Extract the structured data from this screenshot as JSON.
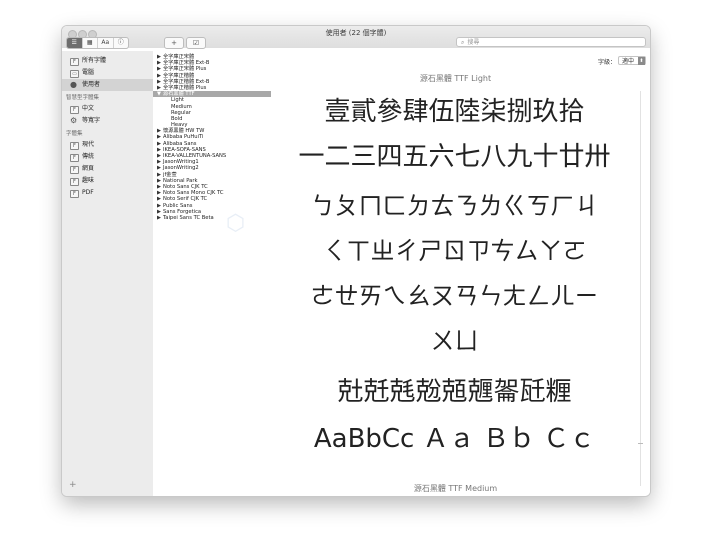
{
  "window": {
    "title": "使用者 (22 個字體)"
  },
  "toolbar": {
    "view_buttons": [
      "☰",
      "▦",
      "Aa",
      "ⓘ"
    ],
    "add_label": "+",
    "check_label": "☑",
    "search_placeholder": "搜尋"
  },
  "sidebar": {
    "collections": [
      {
        "label": "所有字體",
        "icon": "font-book-icon"
      },
      {
        "label": "電腦",
        "icon": "computer-icon"
      },
      {
        "label": "使用者",
        "icon": "user-icon",
        "selected": true
      }
    ],
    "smart_heading": "智慧型字體集",
    "smart_items": [
      {
        "label": "中文",
        "icon": "collection-icon"
      },
      {
        "label": "等寬字",
        "icon": "gear-icon"
      }
    ],
    "sets_heading": "字體集",
    "sets": [
      {
        "label": "現代",
        "icon": "collection-icon"
      },
      {
        "label": "傳統",
        "icon": "collection-icon"
      },
      {
        "label": "網頁",
        "icon": "collection-icon"
      },
      {
        "label": "趣味",
        "icon": "collection-icon"
      },
      {
        "label": "PDF",
        "icon": "collection-icon"
      }
    ],
    "add_label": "+"
  },
  "font_list": [
    {
      "label": "全字庫正宋體",
      "expanded": false
    },
    {
      "label": "全字庫正宋體 Ext-B",
      "expanded": false
    },
    {
      "label": "全字庫正宋體 Plus",
      "expanded": false
    },
    {
      "label": "全字庫正楷體",
      "expanded": false
    },
    {
      "label": "全字庫正楷體 Ext-B",
      "expanded": false
    },
    {
      "label": "全字庫正楷體 Plus",
      "expanded": false
    },
    {
      "label": "源石黑體 TTF",
      "expanded": true,
      "selected": true,
      "faces": [
        "Light",
        "Medium",
        "Regular",
        "Bold",
        "Heavy"
      ]
    },
    {
      "label": "懷源黑體 HW TW",
      "expanded": false
    },
    {
      "label": "Alibaba PuHuiTi",
      "expanded": false
    },
    {
      "label": "Alibaba Sans",
      "expanded": false
    },
    {
      "label": "IKEA-SOFA-SANS",
      "expanded": false
    },
    {
      "label": "IKEA-VALLENTUNA-SANS",
      "expanded": false
    },
    {
      "label": "JasonWriting1",
      "expanded": false
    },
    {
      "label": "JasonWriting2",
      "expanded": false
    },
    {
      "label": "jf金萱",
      "expanded": false
    },
    {
      "label": "National Park",
      "expanded": false
    },
    {
      "label": "Noto Sans CJK TC",
      "expanded": false
    },
    {
      "label": "Noto Sans Mono CJK TC",
      "expanded": false
    },
    {
      "label": "Noto Serif CJK TC",
      "expanded": false
    },
    {
      "label": "Public Sans",
      "expanded": false
    },
    {
      "label": "Sans Forgetica",
      "expanded": false
    },
    {
      "label": "Taipei Sans TC Beta",
      "expanded": false
    }
  ],
  "preview": {
    "size_label": "字級：",
    "size_value": "適中",
    "face_title": "源石黑體 TTF Light",
    "next_face_title": "源石黑體 TTF Medium",
    "lines": [
      "壹貳參肆伍陸柒捌玖拾",
      "一二三四五六七八九十廿卅",
      "ㄅㄆㄇㄈㄉㄊㄋㄌㄍㄎㄏㄐ",
      "ㄑㄒㄓㄔㄕㄖㄗㄘㄙㄚㄛ",
      "ㄜㄝㄞㄟㄠㄡㄢㄣㄤㄥㄦㄧ",
      "ㄨㄩ",
      "兙兛兞兝兡兣嗧瓩糎",
      "AaBbCc Ａａ Ｂｂ Ｃｃ"
    ]
  }
}
